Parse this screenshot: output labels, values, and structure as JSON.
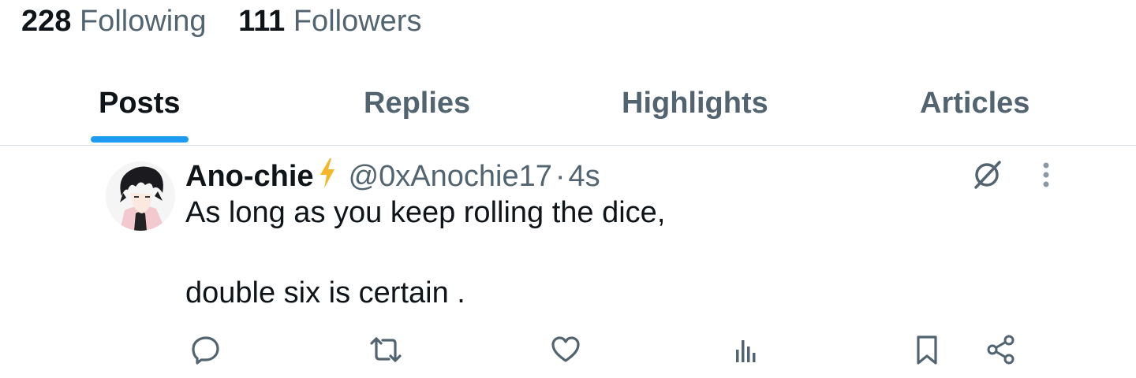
{
  "profile_stats": {
    "following_count": "228",
    "following_label": "Following",
    "followers_count": "111",
    "followers_label": "Followers"
  },
  "tabs": [
    {
      "label": "Posts",
      "active": true
    },
    {
      "label": "Replies",
      "active": false
    },
    {
      "label": "Highlights",
      "active": false
    },
    {
      "label": "Articles",
      "active": false
    }
  ],
  "post": {
    "author_name": "Ano-chie",
    "handle": "@0xAnochie17",
    "separator": "·",
    "time": "4s",
    "text_line1": "As long as you keep rolling the dice,",
    "text_line2": "double six is certain .",
    "actions": [
      "reply-icon",
      "repost-icon",
      "like-icon",
      "views-icon",
      "bookmark-icon",
      "share-icon"
    ]
  },
  "colors": {
    "accent": "#1d9bf0",
    "muted_text": "#536471",
    "text": "#0f1419",
    "badge": "#f5b62a"
  }
}
